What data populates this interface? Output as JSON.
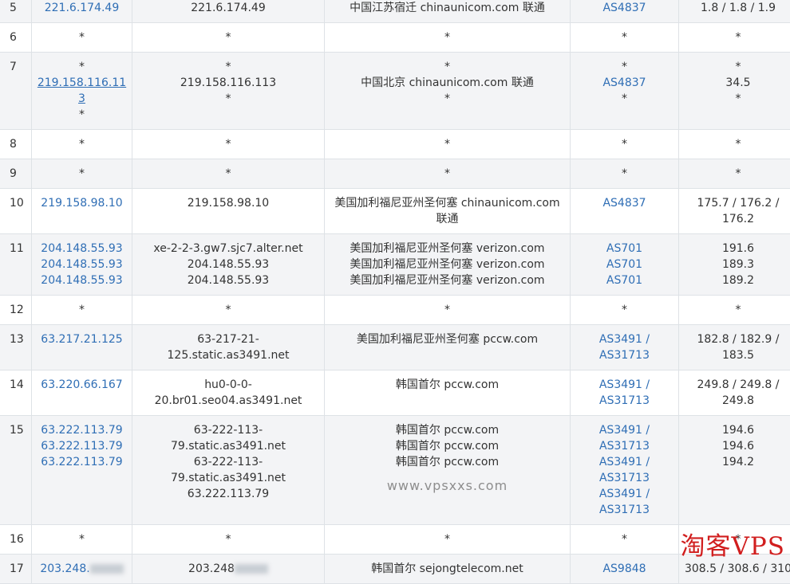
{
  "rows": [
    {
      "hop": "5",
      "ip": [
        "221.6.174.49"
      ],
      "host": [
        "221.6.174.49"
      ],
      "loc": [
        "中国江苏宿迁 chinaunicom.com 联通"
      ],
      "as": [
        "AS4837"
      ],
      "rtt": [
        "1.8 / 1.8 / 1.9"
      ]
    },
    {
      "hop": "6",
      "ip": [
        "*"
      ],
      "host": [
        "*"
      ],
      "loc": [
        "*"
      ],
      "as": [
        "*"
      ],
      "rtt": [
        "*"
      ]
    },
    {
      "hop": "7",
      "ip": [
        "*",
        "219.158.116.113",
        "*"
      ],
      "host": [
        "*",
        "219.158.116.113",
        "*"
      ],
      "loc": [
        "*",
        "中国北京 chinaunicom.com 联通",
        "*"
      ],
      "as": [
        "*",
        "AS4837",
        "*"
      ],
      "rtt": [
        "*",
        "34.5",
        "*"
      ]
    },
    {
      "hop": "8",
      "ip": [
        "*"
      ],
      "host": [
        "*"
      ],
      "loc": [
        "*"
      ],
      "as": [
        "*"
      ],
      "rtt": [
        "*"
      ]
    },
    {
      "hop": "9",
      "ip": [
        "*"
      ],
      "host": [
        "*"
      ],
      "loc": [
        "*"
      ],
      "as": [
        "*"
      ],
      "rtt": [
        "*"
      ]
    },
    {
      "hop": "10",
      "ip": [
        "219.158.98.10"
      ],
      "host": [
        "219.158.98.10"
      ],
      "loc": [
        "美国加利福尼亚州圣何塞 chinaunicom.com 联通"
      ],
      "as": [
        "AS4837"
      ],
      "rtt": [
        "175.7 / 176.2 / 176.2"
      ]
    },
    {
      "hop": "11",
      "ip": [
        "204.148.55.93",
        "204.148.55.93",
        "204.148.55.93"
      ],
      "host": [
        "xe-2-2-3.gw7.sjc7.alter.net",
        "204.148.55.93",
        "204.148.55.93"
      ],
      "loc": [
        "美国加利福尼亚州圣何塞 verizon.com",
        "美国加利福尼亚州圣何塞 verizon.com",
        "美国加利福尼亚州圣何塞 verizon.com"
      ],
      "as": [
        "AS701",
        "AS701",
        "AS701"
      ],
      "rtt": [
        "191.6",
        "189.3",
        "189.2"
      ]
    },
    {
      "hop": "12",
      "ip": [
        "*"
      ],
      "host": [
        "*"
      ],
      "loc": [
        "*"
      ],
      "as": [
        "*"
      ],
      "rtt": [
        "*"
      ]
    },
    {
      "hop": "13",
      "ip": [
        "63.217.21.125"
      ],
      "host": [
        "63-217-21-125.static.as3491.net"
      ],
      "loc": [
        "美国加利福尼亚州圣何塞 pccw.com"
      ],
      "as": [
        "AS3491 / AS31713"
      ],
      "rtt": [
        "182.8 / 182.9 / 183.5"
      ]
    },
    {
      "hop": "14",
      "ip": [
        "63.220.66.167"
      ],
      "host": [
        "hu0-0-0-20.br01.seo04.as3491.net"
      ],
      "loc": [
        "韩国首尔 pccw.com"
      ],
      "as": [
        "AS3491 / AS31713"
      ],
      "rtt": [
        "249.8 / 249.8 / 249.8"
      ]
    },
    {
      "hop": "15",
      "ip": [
        "63.222.113.79",
        "63.222.113.79",
        "63.222.113.79"
      ],
      "host": [
        "63-222-113-79.static.as3491.net",
        "63-222-113-79.static.as3491.net",
        "63.222.113.79"
      ],
      "loc": [
        "韩国首尔 pccw.com",
        "韩国首尔 pccw.com",
        "韩国首尔 pccw.com"
      ],
      "as": [
        "AS3491 /",
        "AS31713",
        "AS3491 /",
        "AS31713",
        "AS3491 /",
        "AS31713"
      ],
      "rtt": [
        "194.6",
        "194.6",
        "194.2"
      ],
      "watermark": "www.vpsxxs.com"
    },
    {
      "hop": "16",
      "ip": [
        "*"
      ],
      "host": [
        "*"
      ],
      "loc": [
        "*"
      ],
      "as": [
        "*"
      ],
      "rtt": [
        "*"
      ]
    },
    {
      "hop": "17",
      "ip": [
        "203.248."
      ],
      "host": [
        "203.248"
      ],
      "loc": [
        "韩国首尔 sejongtelecom.net"
      ],
      "as": [
        "AS9848"
      ],
      "rtt": [
        "308.5 / 308.6 / 310"
      ],
      "blurred": true
    }
  ],
  "logo": "淘客VPS"
}
